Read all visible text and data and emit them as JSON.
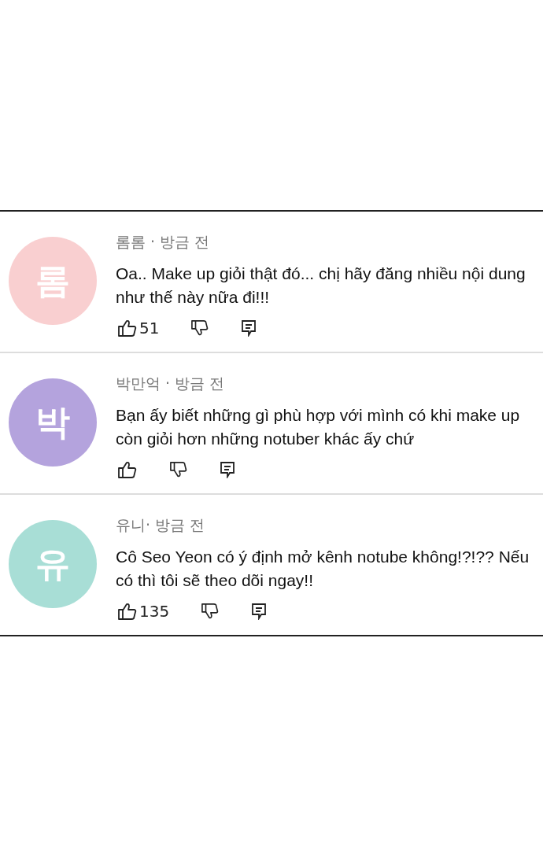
{
  "comments": [
    {
      "avatar": "롬",
      "color": "#f9cfd0",
      "meta": "롬롬 · 방금 전",
      "text": "Oa.. Make up giỏi thật đó... chị hãy đăng nhiều nội dung như thế này nữa đi!!!",
      "likes": "51"
    },
    {
      "avatar": "박",
      "color": "#b4a3dd",
      "meta": "박만억 · 방금 전",
      "text": "Bạn ấy biết những gì phù hợp với mình có khi make up còn giỏi hơn những notuber khác ấy chứ"
    },
    {
      "avatar": "유",
      "color": "#a8ded6",
      "meta": "유니· 방금 전",
      "text": "Cô Seo Yeon có ý định mở kênh notube không!?!?? Nếu có thì tôi sẽ theo dõi ngay!!",
      "likes": "135"
    }
  ]
}
